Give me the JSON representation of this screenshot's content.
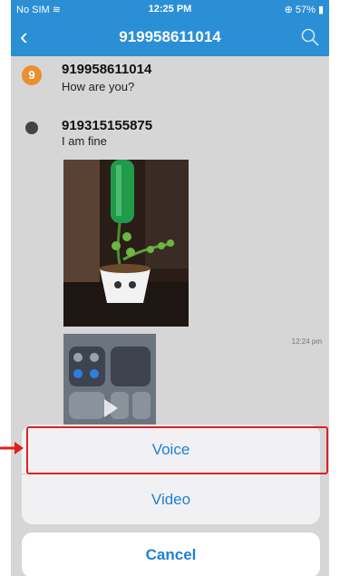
{
  "status": {
    "carrier": "No SIM",
    "time": "12:25 PM",
    "battery": "57%"
  },
  "nav": {
    "title": "919958611014"
  },
  "messages": [
    {
      "avatar": "9",
      "avatar_color": "#e8902f",
      "sender": "919958611014",
      "text": "How are you?"
    },
    {
      "avatar": "",
      "avatar_color": "#444444",
      "sender": "919315155875",
      "text": "I am fine"
    }
  ],
  "images": {
    "timestamp": "12:24 pm"
  },
  "action_sheet": {
    "voice": "Voice",
    "video": "Video",
    "cancel": "Cancel"
  },
  "colors": {
    "header": "#2b8fd6",
    "action": "#1f7fd2",
    "highlight": "#e02020"
  }
}
